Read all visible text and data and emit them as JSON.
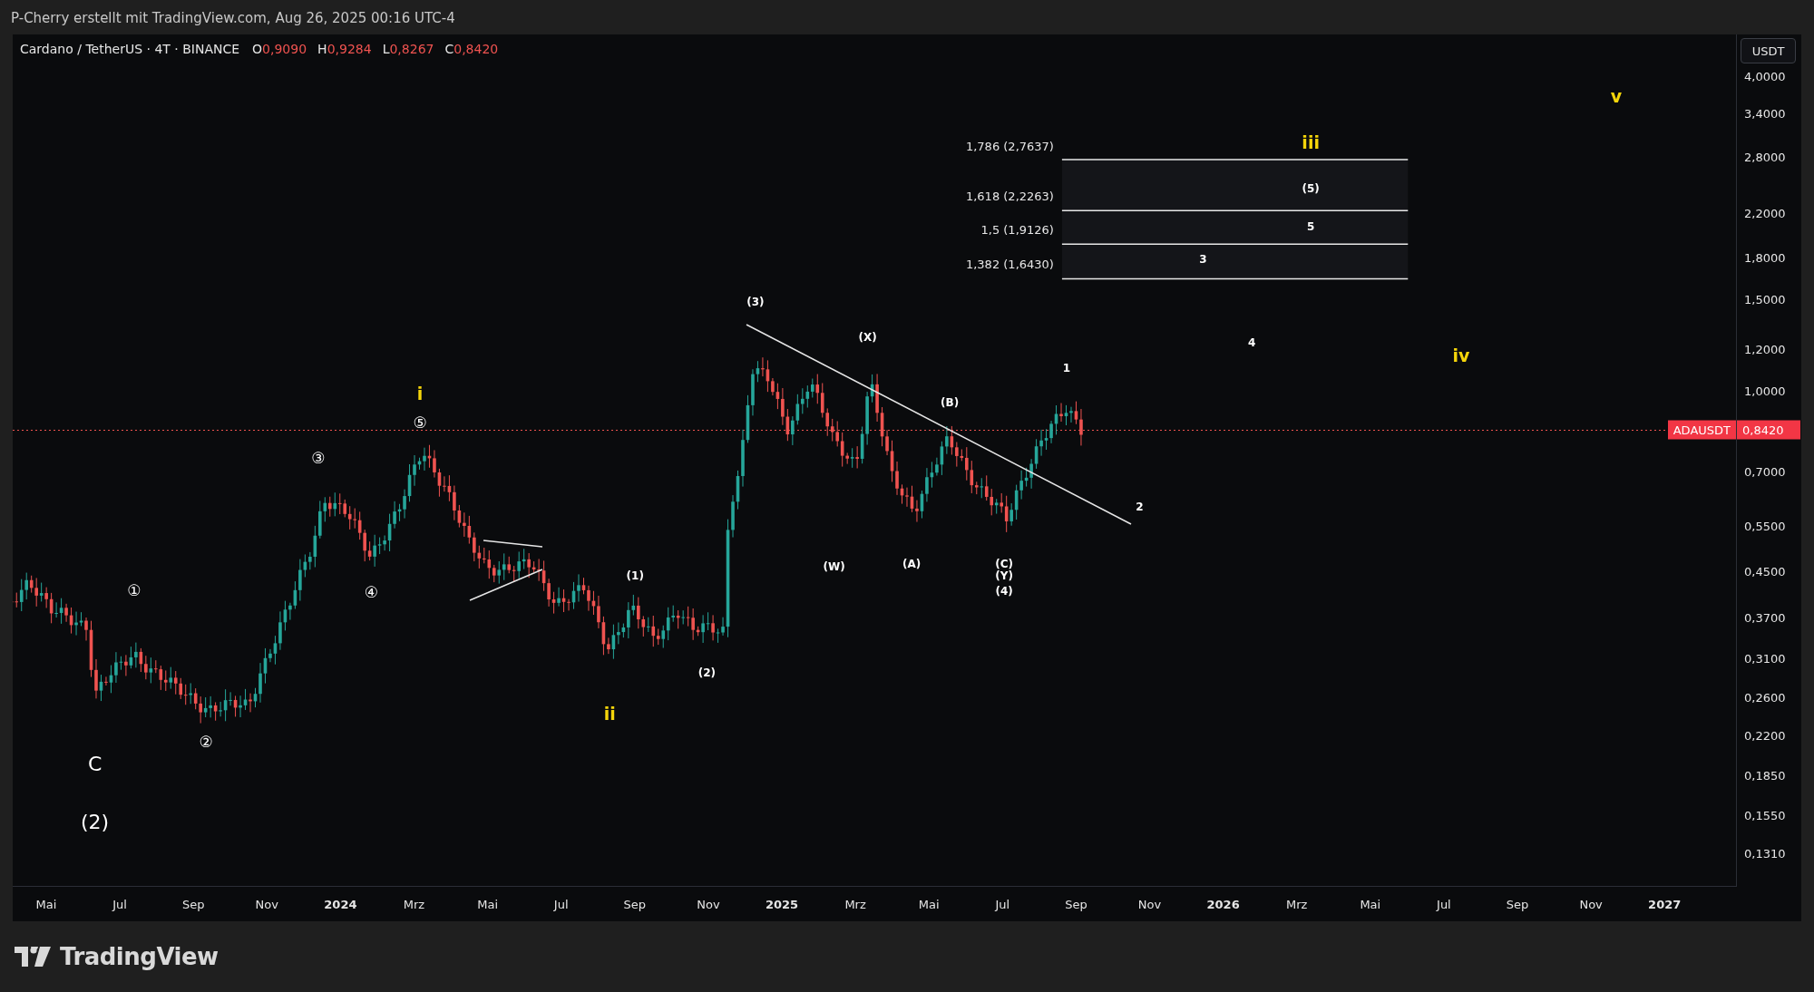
{
  "header": {
    "caption": "P-Cherry erstellt mit TradingView.com, Aug 26, 2025 00:16 UTC-4"
  },
  "legend": {
    "symbol": "Cardano / TetherUS · 4T · BINANCE",
    "ohlc": [
      {
        "key": "O",
        "value": "0,9090"
      },
      {
        "key": "H",
        "value": "0,9284"
      },
      {
        "key": "L",
        "value": "0,8267"
      },
      {
        "key": "C",
        "value": "0,8420"
      }
    ]
  },
  "price_axis": {
    "currency_button": "USDT",
    "labels": [
      "4,0000",
      "3,4000",
      "2,8000",
      "2,2000",
      "1,8000",
      "1,5000",
      "1,2000",
      "1,0000",
      "0,7000",
      "0,5500",
      "0,4500",
      "0,3700",
      "0,3100",
      "0,2600",
      "0,2200",
      "0,1850",
      "0,1550",
      "0,1310"
    ],
    "current_price": {
      "symbol": "ADAUSDT",
      "price": "0,8420"
    }
  },
  "time_axis": {
    "labels": [
      {
        "text": "Mai",
        "kind": "month"
      },
      {
        "text": "Jul",
        "kind": "month"
      },
      {
        "text": "Sep",
        "kind": "month"
      },
      {
        "text": "Nov",
        "kind": "month"
      },
      {
        "text": "2024",
        "kind": "year"
      },
      {
        "text": "Mrz",
        "kind": "month"
      },
      {
        "text": "Mai",
        "kind": "month"
      },
      {
        "text": "Jul",
        "kind": "month"
      },
      {
        "text": "Sep",
        "kind": "month"
      },
      {
        "text": "Nov",
        "kind": "month"
      },
      {
        "text": "2025",
        "kind": "year"
      },
      {
        "text": "Mrz",
        "kind": "month"
      },
      {
        "text": "Mai",
        "kind": "month"
      },
      {
        "text": "Jul",
        "kind": "month"
      },
      {
        "text": "Sep",
        "kind": "month"
      },
      {
        "text": "Nov",
        "kind": "month"
      },
      {
        "text": "2026",
        "kind": "year"
      },
      {
        "text": "Mrz",
        "kind": "month"
      },
      {
        "text": "Mai",
        "kind": "month"
      },
      {
        "text": "Jul",
        "kind": "month"
      },
      {
        "text": "Sep",
        "kind": "month"
      },
      {
        "text": "Nov",
        "kind": "month"
      },
      {
        "text": "2027",
        "kind": "year"
      }
    ]
  },
  "fib_levels": [
    {
      "label": "1,786 (2,7637)"
    },
    {
      "label": "1,618 (2,2263)"
    },
    {
      "label": "1,5 (1,9126)"
    },
    {
      "label": "1,382 (1,6430)"
    }
  ],
  "wave_labels": [
    {
      "text": "C",
      "kind": "major",
      "color": "#ffffff"
    },
    {
      "text": "(2)",
      "kind": "major",
      "color": "#ffffff"
    },
    {
      "text": "①",
      "kind": "circled",
      "color": "#ffffff"
    },
    {
      "text": "②",
      "kind": "circled",
      "color": "#ffffff"
    },
    {
      "text": "③",
      "kind": "circled",
      "color": "#ffffff"
    },
    {
      "text": "④",
      "kind": "circled",
      "color": "#ffffff"
    },
    {
      "text": "i",
      "kind": "roman",
      "color": "#f5d50a"
    },
    {
      "text": "⑤",
      "kind": "circled",
      "color": "#ffffff"
    },
    {
      "text": "ii",
      "kind": "roman",
      "color": "#f5d50a"
    },
    {
      "text": "(1)",
      "kind": "minor",
      "color": "#ffffff"
    },
    {
      "text": "(2)",
      "kind": "minor",
      "color": "#ffffff"
    },
    {
      "text": "(3)",
      "kind": "minor",
      "color": "#ffffff"
    },
    {
      "text": "(W)",
      "kind": "minor",
      "color": "#ffffff"
    },
    {
      "text": "(X)",
      "kind": "minor",
      "color": "#ffffff"
    },
    {
      "text": "(A)",
      "kind": "minor",
      "color": "#ffffff"
    },
    {
      "text": "(B)",
      "kind": "minor",
      "color": "#ffffff"
    },
    {
      "text": "(C)",
      "kind": "minor",
      "color": "#ffffff"
    },
    {
      "text": "(Y)",
      "kind": "minor",
      "color": "#ffffff"
    },
    {
      "text": "(4)",
      "kind": "minor",
      "color": "#ffffff"
    },
    {
      "text": "1",
      "kind": "minor",
      "color": "#ffffff"
    },
    {
      "text": "2",
      "kind": "minor",
      "color": "#ffffff"
    },
    {
      "text": "iii",
      "kind": "roman",
      "color": "#f5d50a"
    },
    {
      "text": "(5)",
      "kind": "minor",
      "color": "#ffffff"
    },
    {
      "text": "5",
      "kind": "minor",
      "color": "#ffffff"
    },
    {
      "text": "3",
      "kind": "minor",
      "color": "#ffffff"
    },
    {
      "text": "4",
      "kind": "minor",
      "color": "#ffffff"
    },
    {
      "text": "iv",
      "kind": "roman",
      "color": "#f5d50a"
    },
    {
      "text": "v",
      "kind": "roman",
      "color": "#f5d50a"
    }
  ],
  "footer": {
    "logo_text": "TradingView"
  }
}
